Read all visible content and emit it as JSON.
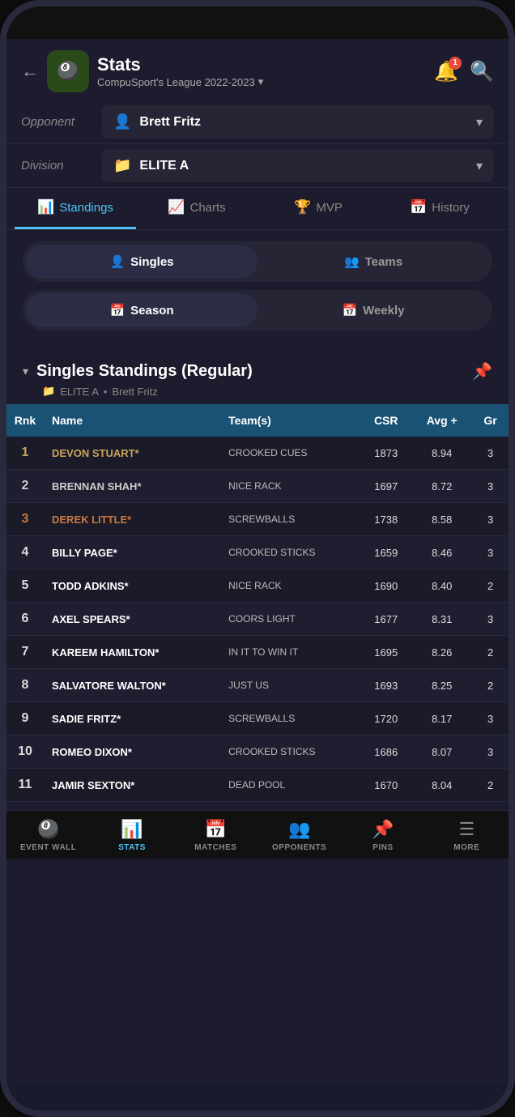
{
  "app": {
    "title": "Stats",
    "subtitle": "CompuSport's League 2022-2023",
    "back_label": "←",
    "logo_emoji": "🎱",
    "notif_count": "1"
  },
  "filters": {
    "opponent_label": "Opponent",
    "opponent_value": "Brett Fritz",
    "division_label": "Division",
    "division_value": "ELITE A"
  },
  "tabs": [
    {
      "label": "Standings",
      "icon": "📊",
      "active": true
    },
    {
      "label": "Charts",
      "icon": "📈",
      "active": false
    },
    {
      "label": "MVP",
      "icon": "🏆",
      "active": false
    },
    {
      "label": "History",
      "icon": "📅",
      "active": false
    }
  ],
  "segments": {
    "type": [
      {
        "label": "Singles",
        "icon": "👤",
        "active": true
      },
      {
        "label": "Teams",
        "icon": "👥",
        "active": false
      }
    ],
    "period": [
      {
        "label": "Season",
        "icon": "📅",
        "active": true
      },
      {
        "label": "Weekly",
        "icon": "📅",
        "active": false
      }
    ]
  },
  "section": {
    "title": "Singles Standings (Regular)",
    "subtitle_division": "ELITE A",
    "subtitle_separator": "•",
    "subtitle_name": "Brett Fritz"
  },
  "table": {
    "columns": [
      "Rnk",
      "Name",
      "Team(s)",
      "CSR",
      "Avg +",
      "Gr"
    ],
    "rows": [
      {
        "rank": "1",
        "name": "DEVON STUART*",
        "team": "CROOKED CUES",
        "csr": "1873",
        "avg": "8.94",
        "gr": "3",
        "rank_class": "rank-1",
        "name_class": "name-gold"
      },
      {
        "rank": "2",
        "name": "BRENNAN SHAH*",
        "team": "NICE RACK",
        "csr": "1697",
        "avg": "8.72",
        "gr": "3",
        "rank_class": "rank-2",
        "name_class": "name-silver"
      },
      {
        "rank": "3",
        "name": "DEREK LITTLE*",
        "team": "SCREWBALLS",
        "csr": "1738",
        "avg": "8.58",
        "gr": "3",
        "rank_class": "rank-3",
        "name_class": "name-bronze"
      },
      {
        "rank": "4",
        "name": "BILLY PAGE*",
        "team": "CROOKED STICKS",
        "csr": "1659",
        "avg": "8.46",
        "gr": "3",
        "rank_class": "rank-default",
        "name_class": "name-default"
      },
      {
        "rank": "5",
        "name": "TODD ADKINS*",
        "team": "NICE RACK",
        "csr": "1690",
        "avg": "8.40",
        "gr": "2",
        "rank_class": "rank-default",
        "name_class": "name-default"
      },
      {
        "rank": "6",
        "name": "AXEL SPEARS*",
        "team": "COORS LIGHT",
        "csr": "1677",
        "avg": "8.31",
        "gr": "3",
        "rank_class": "rank-default",
        "name_class": "name-default"
      },
      {
        "rank": "7",
        "name": "KAREEM HAMILTON*",
        "team": "IN IT TO WIN IT",
        "csr": "1695",
        "avg": "8.26",
        "gr": "2",
        "rank_class": "rank-default",
        "name_class": "name-default"
      },
      {
        "rank": "8",
        "name": "SALVATORE WALTON*",
        "team": "JUST US",
        "csr": "1693",
        "avg": "8.25",
        "gr": "2",
        "rank_class": "rank-default",
        "name_class": "name-default"
      },
      {
        "rank": "9",
        "name": "SADIE FRITZ*",
        "team": "SCREWBALLS",
        "csr": "1720",
        "avg": "8.17",
        "gr": "3",
        "rank_class": "rank-default",
        "name_class": "name-default"
      },
      {
        "rank": "10",
        "name": "ROMEO DIXON*",
        "team": "CROOKED STICKS",
        "csr": "1686",
        "avg": "8.07",
        "gr": "3",
        "rank_class": "rank-default",
        "name_class": "name-default"
      },
      {
        "rank": "11",
        "name": "JAMIR SEXTON*",
        "team": "DEAD POOL",
        "csr": "1670",
        "avg": "8.04",
        "gr": "2",
        "rank_class": "rank-default",
        "name_class": "name-default"
      }
    ]
  },
  "bottom_nav": [
    {
      "label": "EVENT WALL",
      "icon": "🎱",
      "active": false
    },
    {
      "label": "STATS",
      "icon": "📊",
      "active": true
    },
    {
      "label": "MATCHES",
      "icon": "📅",
      "active": false
    },
    {
      "label": "OPPONENTS",
      "icon": "👥",
      "active": false
    },
    {
      "label": "PINS",
      "icon": "📌",
      "active": false
    },
    {
      "label": "MORE",
      "icon": "☰",
      "active": false
    }
  ]
}
